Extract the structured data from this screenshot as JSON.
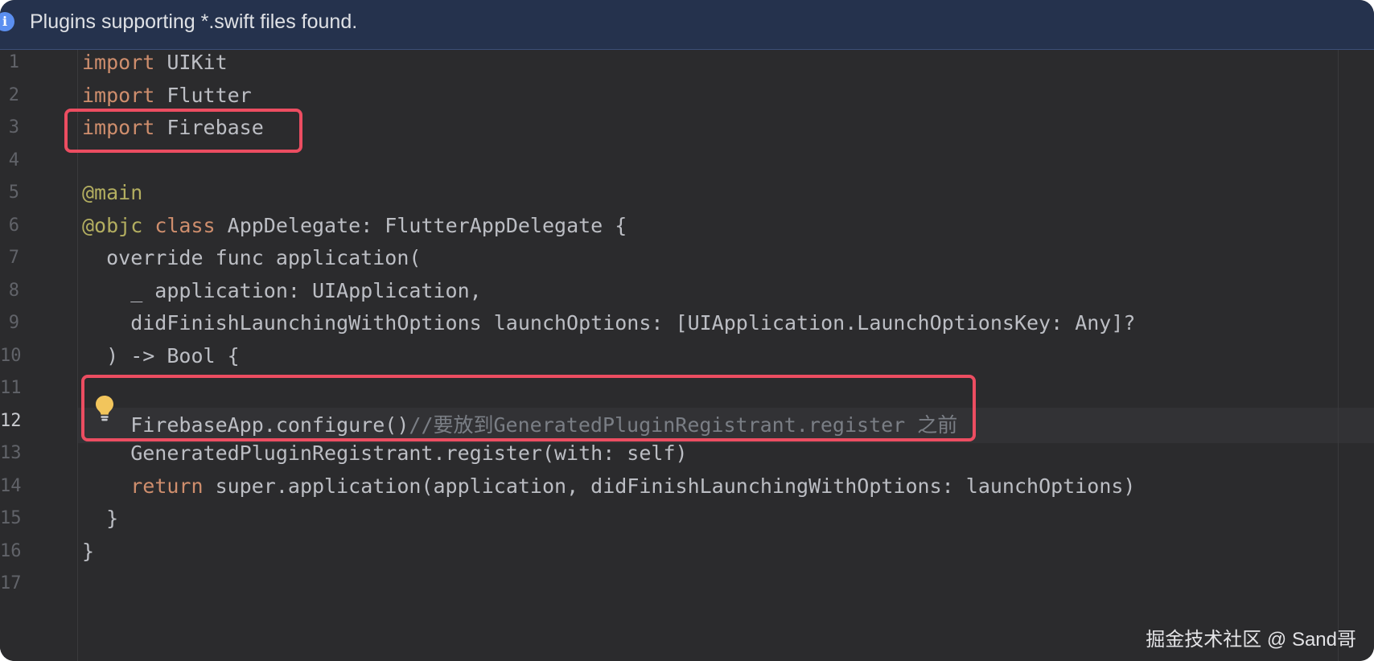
{
  "banner": {
    "message": "Plugins supporting *.swift files found.",
    "icon": "info-icon"
  },
  "editor": {
    "current_line": 12,
    "lines": [
      {
        "n": "1",
        "tokens": [
          {
            "t": "import",
            "c": "kw"
          },
          {
            "t": " UIKit",
            "c": ""
          }
        ]
      },
      {
        "n": "2",
        "tokens": [
          {
            "t": "import",
            "c": "kw"
          },
          {
            "t": " Flutter",
            "c": ""
          }
        ]
      },
      {
        "n": "3",
        "tokens": [
          {
            "t": "import",
            "c": "kw"
          },
          {
            "t": " Firebase",
            "c": ""
          }
        ]
      },
      {
        "n": "4",
        "tokens": []
      },
      {
        "n": "5",
        "tokens": [
          {
            "t": "@main",
            "c": "ann"
          }
        ]
      },
      {
        "n": "6",
        "tokens": [
          {
            "t": "@objc",
            "c": "ann"
          },
          {
            "t": " ",
            "c": ""
          },
          {
            "t": "class",
            "c": "kw"
          },
          {
            "t": " AppDelegate: FlutterAppDelegate {",
            "c": ""
          }
        ]
      },
      {
        "n": "7",
        "tokens": [
          {
            "t": "  override func application(",
            "c": ""
          }
        ]
      },
      {
        "n": "8",
        "tokens": [
          {
            "t": "    _ application: UIApplication,",
            "c": ""
          }
        ]
      },
      {
        "n": "9",
        "tokens": [
          {
            "t": "    didFinishLaunchingWithOptions launchOptions: [UIApplication.LaunchOptionsKey: Any]?",
            "c": ""
          }
        ]
      },
      {
        "n": "10",
        "tokens": [
          {
            "t": "  ) -> Bool {",
            "c": ""
          }
        ]
      },
      {
        "n": "11",
        "tokens": []
      },
      {
        "n": "12",
        "tokens": [
          {
            "t": "    FirebaseApp.configure()",
            "c": ""
          },
          {
            "t": "//要放到GeneratedPluginRegistrant.register 之前",
            "c": "cmt"
          }
        ]
      },
      {
        "n": "13",
        "tokens": [
          {
            "t": "    GeneratedPluginRegistrant.register(with: self)",
            "c": ""
          }
        ]
      },
      {
        "n": "14",
        "tokens": [
          {
            "t": "    ",
            "c": ""
          },
          {
            "t": "return",
            "c": "kw"
          },
          {
            "t": " super.application(application, didFinishLaunchingWithOptions: launchOptions)",
            "c": ""
          }
        ]
      },
      {
        "n": "15",
        "tokens": [
          {
            "t": "  }",
            "c": ""
          }
        ]
      },
      {
        "n": "16",
        "tokens": [
          {
            "t": "}",
            "c": ""
          }
        ]
      },
      {
        "n": "17",
        "tokens": []
      }
    ]
  },
  "icons": {
    "intention_bulb": "lightbulb-icon"
  },
  "colors": {
    "keyword": "#cf8e6d",
    "annotation": "#b3ae60",
    "comment": "#7a7e85",
    "text": "#bcbec4",
    "highlight_box": "#ec4d61",
    "banner_bg": "#25324d"
  },
  "watermark": {
    "text": "掘金技术社区 @ Sand哥"
  }
}
